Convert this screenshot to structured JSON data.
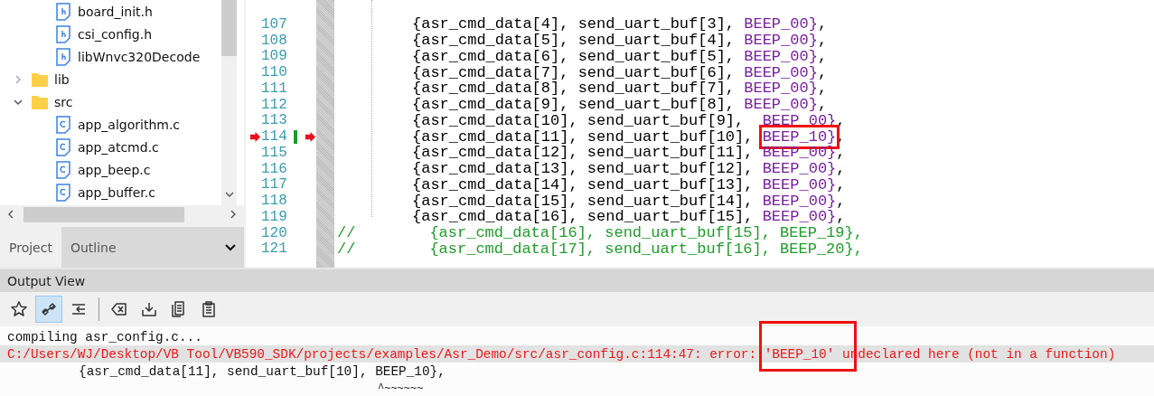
{
  "project_tree": [
    {
      "kind": "continuation",
      "children": [
        {
          "label": "board_init.h",
          "kind": "header"
        },
        {
          "label": "csi_config.h",
          "kind": "header"
        },
        {
          "label": "libWnvc320Decode",
          "kind": "header"
        }
      ]
    },
    {
      "label": "lib",
      "kind": "folder",
      "expanded": false
    },
    {
      "label": "src",
      "kind": "folder",
      "expanded": true,
      "children": [
        {
          "label": "app_algorithm.c",
          "kind": "source"
        },
        {
          "label": "app_atcmd.c",
          "kind": "source"
        },
        {
          "label": "app_beep.c",
          "kind": "source"
        },
        {
          "label": "app_buffer.c",
          "kind": "source"
        }
      ]
    }
  ],
  "panel_tabs": [
    {
      "label": "Project",
      "selected": false
    },
    {
      "label": "Outline",
      "selected": true
    }
  ],
  "editor": {
    "lines": [
      {
        "number": "107",
        "kind": "code",
        "code": "{asr_cmd_data[4], send_uart_buf[3], ",
        "macro": "BEEP_00",
        "tail": "},",
        "breakpoint": false,
        "highlighted": false
      },
      {
        "number": "108",
        "kind": "code",
        "code": "{asr_cmd_data[5], send_uart_buf[4], ",
        "macro": "BEEP_00",
        "tail": "},",
        "breakpoint": false,
        "highlighted": false
      },
      {
        "number": "109",
        "kind": "code",
        "code": "{asr_cmd_data[6], send_uart_buf[5], ",
        "macro": "BEEP_00",
        "tail": "},",
        "breakpoint": false,
        "highlighted": false
      },
      {
        "number": "110",
        "kind": "code",
        "code": "{asr_cmd_data[7], send_uart_buf[6], ",
        "macro": "BEEP_00",
        "tail": "},",
        "breakpoint": false,
        "highlighted": false
      },
      {
        "number": "111",
        "kind": "code",
        "code": "{asr_cmd_data[8], send_uart_buf[7], ",
        "macro": "BEEP_00",
        "tail": "},",
        "breakpoint": false,
        "highlighted": false
      },
      {
        "number": "112",
        "kind": "code",
        "code": "{asr_cmd_data[9], send_uart_buf[8], ",
        "macro": "BEEP_00",
        "tail": "},",
        "breakpoint": false,
        "highlighted": false
      },
      {
        "number": "113",
        "kind": "code",
        "code": "{asr_cmd_data[10], send_uart_buf[9],  ",
        "macro": "BEEP_00",
        "tail": "},",
        "breakpoint": false,
        "highlighted": false
      },
      {
        "number": "114",
        "kind": "code",
        "code": "{asr_cmd_data[11], send_uart_buf[10], ",
        "macro": "BEEP_10",
        "tail": "},",
        "breakpoint": true,
        "highlighted": true
      },
      {
        "number": "115",
        "kind": "code",
        "code": "{asr_cmd_data[12], send_uart_buf[11], ",
        "macro": "BEEP_00",
        "tail": "},",
        "breakpoint": false,
        "highlighted": false
      },
      {
        "number": "116",
        "kind": "code",
        "code": "{asr_cmd_data[13], send_uart_buf[12], ",
        "macro": "BEEP_00",
        "tail": "},",
        "breakpoint": false,
        "highlighted": false
      },
      {
        "number": "117",
        "kind": "code",
        "code": "{asr_cmd_data[14], send_uart_buf[13], ",
        "macro": "BEEP_00",
        "tail": "},",
        "breakpoint": false,
        "highlighted": false
      },
      {
        "number": "118",
        "kind": "code",
        "code": "{asr_cmd_data[15], send_uart_buf[14], ",
        "macro": "BEEP_00",
        "tail": "},",
        "breakpoint": false,
        "highlighted": false
      },
      {
        "number": "119",
        "kind": "code",
        "code": "{asr_cmd_data[16], send_uart_buf[15], ",
        "macro": "BEEP_00",
        "tail": "},",
        "breakpoint": false,
        "highlighted": false
      },
      {
        "number": "120",
        "kind": "comment",
        "slashes": "//",
        "code": "{asr_cmd_data[16], send_uart_buf[15], BEEP_19},",
        "breakpoint": false,
        "highlighted": false
      },
      {
        "number": "121",
        "kind": "comment",
        "slashes": "//",
        "code": "{asr_cmd_data[17], send_uart_buf[16], BEEP_20},",
        "breakpoint": false,
        "highlighted": false
      }
    ]
  },
  "output_view": {
    "title": "Output View",
    "toolbar": [
      {
        "kind": "star",
        "selected": false
      },
      {
        "kind": "link",
        "selected": true
      },
      {
        "kind": "wrap",
        "selected": false
      },
      {
        "kind": "separator"
      },
      {
        "kind": "clear",
        "selected": false
      },
      {
        "kind": "save",
        "selected": false
      },
      {
        "kind": "copy",
        "selected": false
      },
      {
        "kind": "paste",
        "selected": false
      }
    ],
    "lines": [
      {
        "kind": "info",
        "text": "compiling asr_config.c..."
      },
      {
        "kind": "error",
        "text": "C:/Users/WJ/Desktop/VB Tool/VB590_SDK/projects/examples/Asr_Demo/src/asr_config.c:114:47: error: 'BEEP_10' undeclared here (not in a function)"
      },
      {
        "kind": "source",
        "text": "{asr_cmd_data[11], send_uart_buf[10], BEEP_10},"
      },
      {
        "kind": "caret",
        "text": "^~~~~~~"
      }
    ]
  }
}
